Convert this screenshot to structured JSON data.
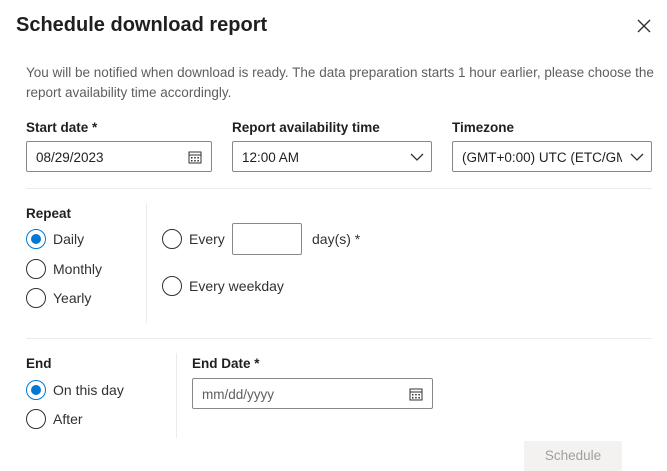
{
  "dialog": {
    "title": "Schedule download report",
    "notice": "You will be notified when download is ready. The data preparation starts 1 hour earlier, please choose the report availability time accordingly."
  },
  "start_date": {
    "label": "Start date *",
    "value": "08/29/2023",
    "icon": "calendar-icon"
  },
  "availability": {
    "label": "Report availability time",
    "value": "12:00 AM",
    "icon": "chevron-down-icon"
  },
  "timezone": {
    "label": "Timezone",
    "value": "(GMT+0:00) UTC (ETC/GM",
    "icon": "chevron-down-icon"
  },
  "repeat": {
    "label": "Repeat",
    "options": [
      {
        "label": "Daily",
        "checked": true
      },
      {
        "label": "Monthly",
        "checked": false
      },
      {
        "label": "Yearly",
        "checked": false
      }
    ],
    "daily_options": {
      "every_label": "Every",
      "every_value": "",
      "days_suffix": "day(s) *",
      "weekday_label": "Every weekday"
    }
  },
  "end": {
    "label": "End",
    "options": [
      {
        "label": "On this day",
        "checked": true
      },
      {
        "label": "After",
        "checked": false
      }
    ],
    "end_date_label": "End Date *",
    "end_date_placeholder": "mm/dd/yyyy"
  },
  "actions": {
    "schedule_label": "Schedule"
  },
  "colors": {
    "accent": "#0078d4",
    "disabled_bg": "#f3f2f1",
    "disabled_text": "#a19f9d"
  }
}
